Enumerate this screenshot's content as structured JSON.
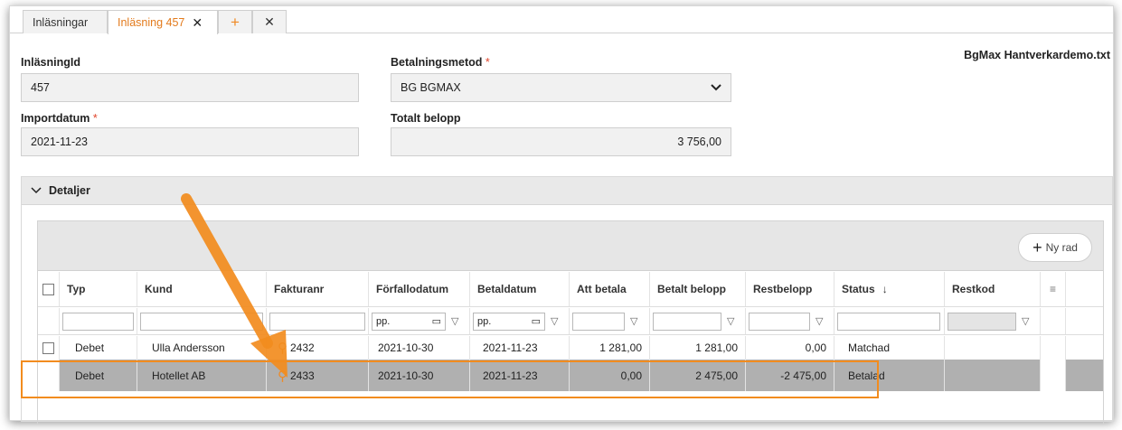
{
  "tabs": {
    "t1": "Inläsningar",
    "t2": "Inläsning 457",
    "close_glyph": "✕",
    "plus_glyph": "+",
    "close_all_glyph": "✕"
  },
  "file_name": "BgMax Hantverkardemo.txt",
  "form": {
    "id_label": "InläsningId",
    "id_value": "457",
    "method_label": "Betalningsmetod",
    "method_value": "BG BGMAX",
    "import_label": "Importdatum",
    "import_value": "2021-11-23",
    "total_label": "Totalt belopp",
    "total_value": "3 756,00",
    "required_marker": "*"
  },
  "section": {
    "title": "Detaljer"
  },
  "grid": {
    "new_row": "Ny rad",
    "columns": [
      "Typ",
      "Kund",
      "Fakturanr",
      "Förfallodatum",
      "Betaldatum",
      "Att betala",
      "Betalt belopp",
      "Restbelopp",
      "Status",
      "Restkod"
    ],
    "sort_glyph": "↓",
    "date_placeholder": "pp.",
    "rows": [
      {
        "typ": "Debet",
        "kund": "Ulla Andersson",
        "faktura": "2432",
        "forfall": "2021-10-30",
        "betal": "2021-11-23",
        "att": "1 281,00",
        "betalt": "1 281,00",
        "rest": "0,00",
        "status": "Matchad"
      },
      {
        "typ": "Debet",
        "kund": "Hotellet AB",
        "faktura": "2433",
        "forfall": "2021-10-30",
        "betal": "2021-11-23",
        "att": "0,00",
        "betalt": "2 475,00",
        "rest": "-2 475,00",
        "status": "Betalad"
      }
    ]
  },
  "colors": {
    "accent": "#f28c1e",
    "selected_row": "#b0b0b0"
  }
}
